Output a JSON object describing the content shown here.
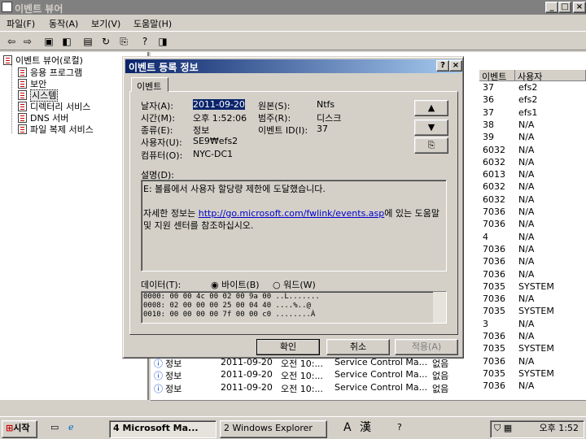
{
  "window": {
    "title": "이벤트 뷰어",
    "min": "_",
    "max": "□",
    "close": "×"
  },
  "menu": [
    "파일(F)",
    "동작(A)",
    "보기(V)",
    "도움말(H)"
  ],
  "tree": {
    "root": "이벤트 뷰어(로컬)",
    "items": [
      "응용 프로그램",
      "보안",
      "시스템",
      "디렉터리 서비스",
      "DNS 서버",
      "파일 복제 서비스"
    ]
  },
  "list": {
    "col_event": "이벤트",
    "col_user": "사용자",
    "rows": [
      {
        "event": "37",
        "user": "efs2"
      },
      {
        "event": "36",
        "user": "efs2"
      },
      {
        "event": "37",
        "user": "efs1"
      },
      {
        "event": "38",
        "user": "N/A"
      },
      {
        "event": "39",
        "user": "N/A"
      },
      {
        "event": "6032",
        "user": "N/A"
      },
      {
        "event": "6032",
        "user": "N/A"
      },
      {
        "event": "6013",
        "user": "N/A"
      },
      {
        "event": "6032",
        "user": "N/A"
      },
      {
        "event": "6032",
        "user": "N/A"
      },
      {
        "event": "7036",
        "user": "N/A"
      },
      {
        "event": "7036",
        "user": "N/A"
      },
      {
        "event": "4",
        "user": "N/A"
      },
      {
        "event": "7036",
        "user": "N/A"
      },
      {
        "event": "7036",
        "user": "N/A"
      },
      {
        "event": "7036",
        "user": "N/A"
      },
      {
        "event": "7035",
        "user": "SYSTEM"
      },
      {
        "event": "7036",
        "user": "N/A"
      },
      {
        "event": "7035",
        "user": "SYSTEM"
      },
      {
        "event": "3",
        "user": "N/A"
      },
      {
        "event": "7036",
        "user": "N/A"
      },
      {
        "event": "7035",
        "user": "SYSTEM"
      },
      {
        "event": "7036",
        "user": "N/A"
      },
      {
        "event": "7035",
        "user": "SYSTEM"
      },
      {
        "event": "7036",
        "user": "N/A"
      }
    ],
    "bottom_rows": [
      {
        "type": "정보",
        "date": "2011-09-20",
        "time": "오전 10:...",
        "source": "Service Control Ma...",
        "category": "없음"
      },
      {
        "type": "정보",
        "date": "2011-09-20",
        "time": "오전 10:...",
        "source": "Service Control Ma...",
        "category": "없음"
      },
      {
        "type": "정보",
        "date": "2011-09-20",
        "time": "오전 10:...",
        "source": "Service Control Ma...",
        "category": "없음"
      }
    ]
  },
  "dialog": {
    "title": "이벤트 등록 정보",
    "help": "?",
    "close": "×",
    "tab": "이벤트",
    "date_label": "날자(A):",
    "date_value": "2011-09-20",
    "source_label": "원본(S):",
    "source_value": "Ntfs",
    "time_label": "시간(M):",
    "time_value": "오후 1:52:06",
    "category_label": "범주(R):",
    "category_value": "디스크",
    "type_label": "종류(E):",
    "type_value": "정보",
    "eventid_label": "이벤트 ID(I):",
    "eventid_value": "37",
    "user_label": "사용자(U):",
    "user_value": "SE9₩efs2",
    "computer_label": "컴퓨터(O):",
    "computer_value": "NYC-DC1",
    "desc_label": "설명(D):",
    "desc_line1": "E: 볼륨에서 사용자 할당량 제한에 도달했습니다.",
    "desc_more_prefix": "자세한 정보는 ",
    "desc_link": "http://go.microsoft.com/fwlink/events.asp",
    "desc_more_suffix": "에 있는 도움말",
    "desc_line3": "및 지원 센터를 참조하십시오.",
    "data_label": "데이터(T):",
    "radio_bytes": "바이트(B)",
    "radio_words": "워드(W)",
    "hex_lines": [
      "0000: 00 00 4c 00 02 00 9a 00    ..L.......",
      "0008: 02 00 00 00 25 00 04 40    ....%..@",
      "0010: 00 00 00 00 7f 00 00 c0    ........À"
    ],
    "ok": "확인",
    "cancel": "취소",
    "apply": "적용(A)"
  },
  "taskbar": {
    "start": "시작",
    "task1": "4 Microsoft Ma...",
    "task2": "2 Windows Explorer",
    "ime_a": "A",
    "ime_han": "漢",
    "clock": "오후 1:52"
  }
}
